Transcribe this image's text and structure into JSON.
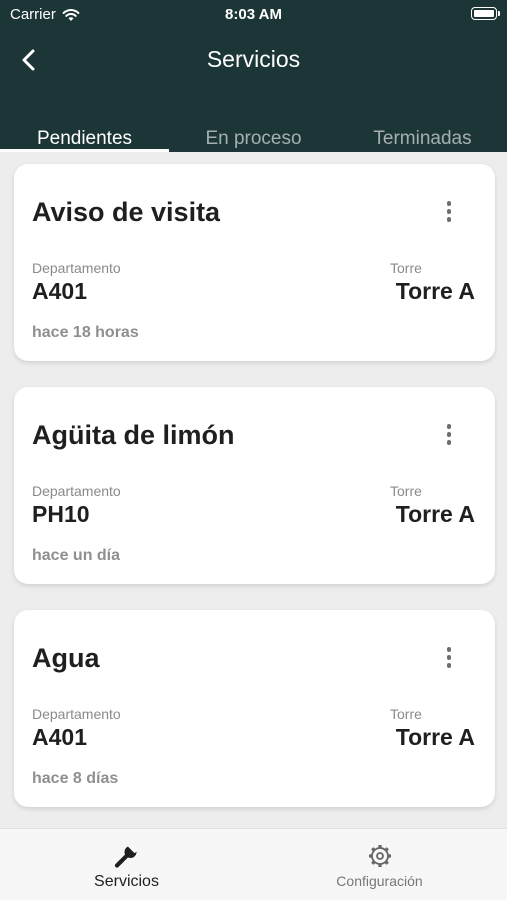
{
  "status_bar": {
    "carrier": "Carrier",
    "time": "8:03 AM",
    "wifi_icon": "wifi-icon",
    "battery_icon": "battery-icon"
  },
  "nav": {
    "title": "Servicios",
    "back_icon": "chevron-left-icon"
  },
  "tabs": [
    {
      "label": "Pendientes",
      "active": true
    },
    {
      "label": "En proceso",
      "active": false
    },
    {
      "label": "Terminadas",
      "active": false
    }
  ],
  "cards": [
    {
      "title": "Aviso de visita",
      "department_label": "Departamento",
      "department": "A401",
      "tower_label": "Torre",
      "tower": "Torre A",
      "time": "hace 18 horas"
    },
    {
      "title": "Agüita de limón",
      "department_label": "Departamento",
      "department": "PH10",
      "tower_label": "Torre",
      "tower": "Torre A",
      "time": "hace un día"
    },
    {
      "title": "Agua",
      "department_label": "Departamento",
      "department": "A401",
      "tower_label": "Torre",
      "tower": "Torre A",
      "time": "hace 8 días"
    }
  ],
  "bottom_nav": [
    {
      "label": "Servicios",
      "icon": "wrench-icon",
      "active": true
    },
    {
      "label": "Configuración",
      "icon": "gear-icon",
      "active": false
    }
  ],
  "colors": {
    "header": "#1c3536",
    "background": "#ededed",
    "card": "#ffffff",
    "text": "#1f1f1f",
    "muted": "#8a8a8a"
  }
}
